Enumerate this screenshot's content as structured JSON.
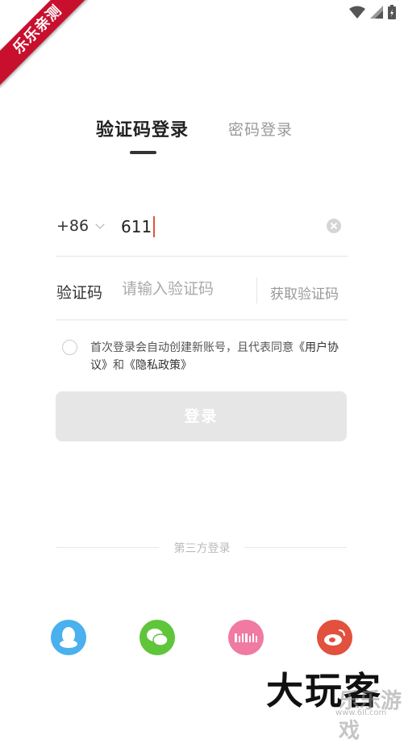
{
  "ribbon": {
    "text": "乐乐亲测"
  },
  "tabs": {
    "active": "验证码登录",
    "inactive": "密码登录"
  },
  "phone": {
    "country_code": "+86",
    "value": "611"
  },
  "code": {
    "label": "验证码",
    "placeholder": "请输入验证码",
    "get_code": "获取验证码"
  },
  "agreement": {
    "prefix": "首次登录会自动创建新账号，且代表同意",
    "user_agreement": "《用户协议》",
    "and": "和",
    "privacy": "《隐私政策》"
  },
  "login": {
    "label": "登录"
  },
  "third_party": {
    "label": "第三方登录",
    "items": [
      "qq-icon",
      "wechat-icon",
      "bilibili-icon",
      "weibo-icon"
    ]
  },
  "colors": {
    "qq": "#4ab0ee",
    "wechat": "#5fc53a",
    "bilibili": "#f07aa1",
    "weibo": "#e2503e"
  },
  "watermark": {
    "main": "大玩客",
    "secondary": "乐乐游戏",
    "url": "www.6ll.com"
  }
}
